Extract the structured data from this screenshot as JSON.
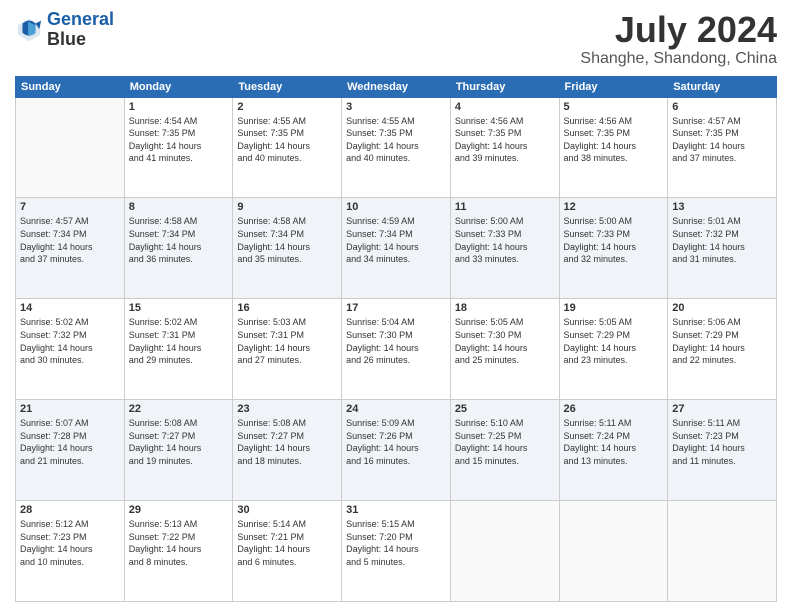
{
  "logo": {
    "line1": "General",
    "line2": "Blue"
  },
  "title": "July 2024",
  "location": "Shanghe, Shandong, China",
  "days_of_week": [
    "Sunday",
    "Monday",
    "Tuesday",
    "Wednesday",
    "Thursday",
    "Friday",
    "Saturday"
  ],
  "weeks": [
    [
      {
        "day": "",
        "info": ""
      },
      {
        "day": "1",
        "info": "Sunrise: 4:54 AM\nSunset: 7:35 PM\nDaylight: 14 hours\nand 41 minutes."
      },
      {
        "day": "2",
        "info": "Sunrise: 4:55 AM\nSunset: 7:35 PM\nDaylight: 14 hours\nand 40 minutes."
      },
      {
        "day": "3",
        "info": "Sunrise: 4:55 AM\nSunset: 7:35 PM\nDaylight: 14 hours\nand 40 minutes."
      },
      {
        "day": "4",
        "info": "Sunrise: 4:56 AM\nSunset: 7:35 PM\nDaylight: 14 hours\nand 39 minutes."
      },
      {
        "day": "5",
        "info": "Sunrise: 4:56 AM\nSunset: 7:35 PM\nDaylight: 14 hours\nand 38 minutes."
      },
      {
        "day": "6",
        "info": "Sunrise: 4:57 AM\nSunset: 7:35 PM\nDaylight: 14 hours\nand 37 minutes."
      }
    ],
    [
      {
        "day": "7",
        "info": "Sunrise: 4:57 AM\nSunset: 7:34 PM\nDaylight: 14 hours\nand 37 minutes."
      },
      {
        "day": "8",
        "info": "Sunrise: 4:58 AM\nSunset: 7:34 PM\nDaylight: 14 hours\nand 36 minutes."
      },
      {
        "day": "9",
        "info": "Sunrise: 4:58 AM\nSunset: 7:34 PM\nDaylight: 14 hours\nand 35 minutes."
      },
      {
        "day": "10",
        "info": "Sunrise: 4:59 AM\nSunset: 7:34 PM\nDaylight: 14 hours\nand 34 minutes."
      },
      {
        "day": "11",
        "info": "Sunrise: 5:00 AM\nSunset: 7:33 PM\nDaylight: 14 hours\nand 33 minutes."
      },
      {
        "day": "12",
        "info": "Sunrise: 5:00 AM\nSunset: 7:33 PM\nDaylight: 14 hours\nand 32 minutes."
      },
      {
        "day": "13",
        "info": "Sunrise: 5:01 AM\nSunset: 7:32 PM\nDaylight: 14 hours\nand 31 minutes."
      }
    ],
    [
      {
        "day": "14",
        "info": "Sunrise: 5:02 AM\nSunset: 7:32 PM\nDaylight: 14 hours\nand 30 minutes."
      },
      {
        "day": "15",
        "info": "Sunrise: 5:02 AM\nSunset: 7:31 PM\nDaylight: 14 hours\nand 29 minutes."
      },
      {
        "day": "16",
        "info": "Sunrise: 5:03 AM\nSunset: 7:31 PM\nDaylight: 14 hours\nand 27 minutes."
      },
      {
        "day": "17",
        "info": "Sunrise: 5:04 AM\nSunset: 7:30 PM\nDaylight: 14 hours\nand 26 minutes."
      },
      {
        "day": "18",
        "info": "Sunrise: 5:05 AM\nSunset: 7:30 PM\nDaylight: 14 hours\nand 25 minutes."
      },
      {
        "day": "19",
        "info": "Sunrise: 5:05 AM\nSunset: 7:29 PM\nDaylight: 14 hours\nand 23 minutes."
      },
      {
        "day": "20",
        "info": "Sunrise: 5:06 AM\nSunset: 7:29 PM\nDaylight: 14 hours\nand 22 minutes."
      }
    ],
    [
      {
        "day": "21",
        "info": "Sunrise: 5:07 AM\nSunset: 7:28 PM\nDaylight: 14 hours\nand 21 minutes."
      },
      {
        "day": "22",
        "info": "Sunrise: 5:08 AM\nSunset: 7:27 PM\nDaylight: 14 hours\nand 19 minutes."
      },
      {
        "day": "23",
        "info": "Sunrise: 5:08 AM\nSunset: 7:27 PM\nDaylight: 14 hours\nand 18 minutes."
      },
      {
        "day": "24",
        "info": "Sunrise: 5:09 AM\nSunset: 7:26 PM\nDaylight: 14 hours\nand 16 minutes."
      },
      {
        "day": "25",
        "info": "Sunrise: 5:10 AM\nSunset: 7:25 PM\nDaylight: 14 hours\nand 15 minutes."
      },
      {
        "day": "26",
        "info": "Sunrise: 5:11 AM\nSunset: 7:24 PM\nDaylight: 14 hours\nand 13 minutes."
      },
      {
        "day": "27",
        "info": "Sunrise: 5:11 AM\nSunset: 7:23 PM\nDaylight: 14 hours\nand 11 minutes."
      }
    ],
    [
      {
        "day": "28",
        "info": "Sunrise: 5:12 AM\nSunset: 7:23 PM\nDaylight: 14 hours\nand 10 minutes."
      },
      {
        "day": "29",
        "info": "Sunrise: 5:13 AM\nSunset: 7:22 PM\nDaylight: 14 hours\nand 8 minutes."
      },
      {
        "day": "30",
        "info": "Sunrise: 5:14 AM\nSunset: 7:21 PM\nDaylight: 14 hours\nand 6 minutes."
      },
      {
        "day": "31",
        "info": "Sunrise: 5:15 AM\nSunset: 7:20 PM\nDaylight: 14 hours\nand 5 minutes."
      },
      {
        "day": "",
        "info": ""
      },
      {
        "day": "",
        "info": ""
      },
      {
        "day": "",
        "info": ""
      }
    ]
  ]
}
